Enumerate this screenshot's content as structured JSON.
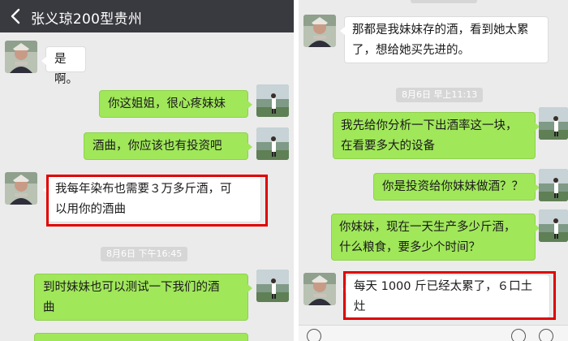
{
  "left": {
    "title": "张义琼200型贵州",
    "messages": [
      {
        "text": "是啊。"
      },
      {
        "text": "你这姐姐，很心疼妹妹"
      },
      {
        "text": "酒曲，你应该也有投资吧"
      },
      {
        "line1": "我每年染布也需要３万多斤酒，可",
        "line2": "以用你的酒曲"
      },
      {
        "line1": "到时妹妹也可以测试一下我们的酒",
        "line2": "曲"
      }
    ],
    "timestamp": "8月6日  下午16:45"
  },
  "right": {
    "messages": [
      {
        "line1": "那都是我妹妹存的酒，看到她太累",
        "line2": "了，想给她买先进的。"
      },
      {
        "line1": "我先给你分析一下出酒率这一块，",
        "line2": "在看要多大的设备"
      },
      {
        "text": "你是投资给你妹妹做酒？？"
      },
      {
        "line1": "你妹妹，现在一天生产多少斤酒，",
        "line2": "什么粮食，要多少个时间？"
      },
      {
        "line1": "每天 1000 斤已经太累了，６口土",
        "line2": "灶"
      }
    ],
    "timestamp": "8月6日  早上11:13"
  },
  "colors": {
    "titlebar": "#393a3f",
    "chat_bg": "#ebebeb",
    "outgoing_bubble": "#a0e75a",
    "incoming_bubble": "#ffffff",
    "highlight": "#e00000"
  },
  "icons": {
    "back": "chevron-left-icon",
    "voice": "voice-icon",
    "emoji": "emoji-icon",
    "add": "plus-circle-icon"
  }
}
